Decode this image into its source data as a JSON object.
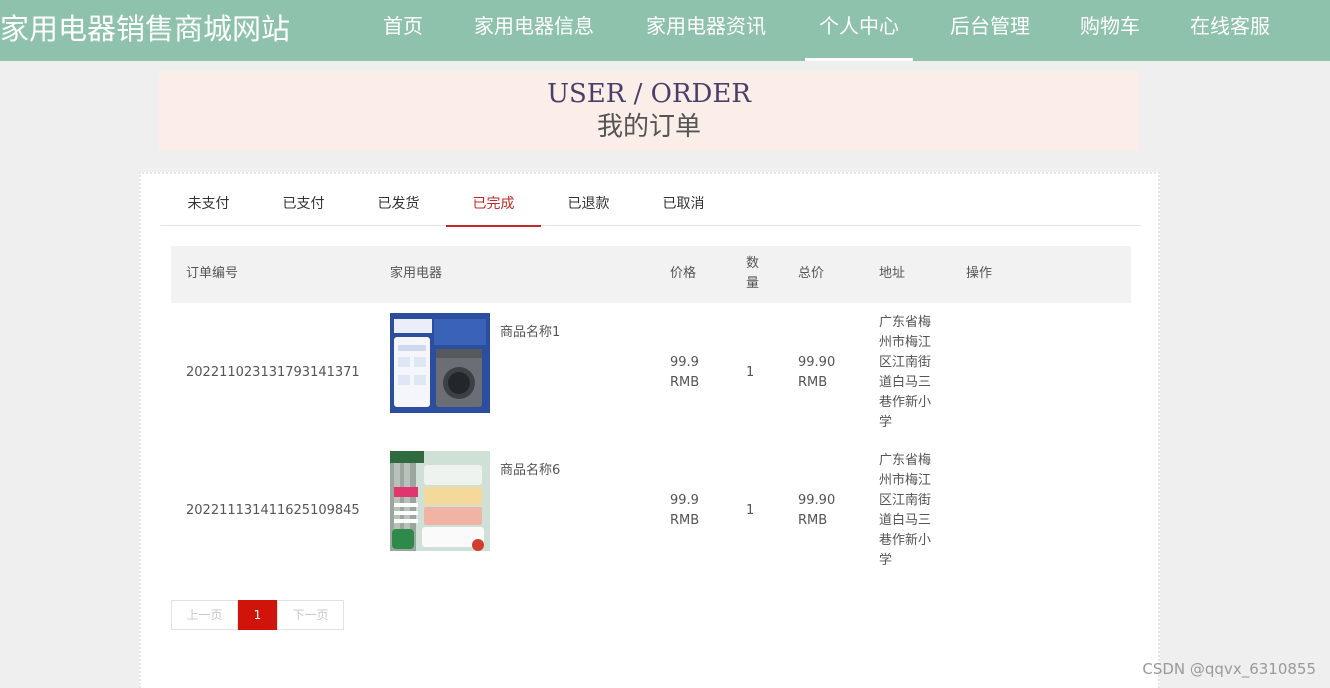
{
  "site": {
    "title": "家用电器销售商城网站",
    "nav": [
      {
        "label": "首页"
      },
      {
        "label": "家用电器信息"
      },
      {
        "label": "家用电器资讯"
      },
      {
        "label": "个人中心",
        "active": true
      },
      {
        "label": "后台管理"
      },
      {
        "label": "购物车"
      },
      {
        "label": "在线客服"
      }
    ]
  },
  "banner": {
    "en": "USER / ORDER",
    "cn": "我的订单"
  },
  "tabs": [
    {
      "label": "未支付"
    },
    {
      "label": "已支付"
    },
    {
      "label": "已发货"
    },
    {
      "label": "已完成",
      "active": true
    },
    {
      "label": "已退款"
    },
    {
      "label": "已取消"
    }
  ],
  "table": {
    "headers": [
      "订单编号",
      "家用电器",
      "价格",
      "数量",
      "总价",
      "地址",
      "操作"
    ],
    "rows": [
      {
        "order_no": "202211023131793141371",
        "product": "商品名称1",
        "thumb": "washing-machine-image",
        "price": "99.9",
        "price_unit": "RMB",
        "qty": "1",
        "total": "99.90",
        "total_unit": "RMB",
        "address": "广东省梅州市梅江区江南街道白马三巷作新小学"
      },
      {
        "order_no": "202211131411625109845",
        "product": "商品名称6",
        "thumb": "fruit-steamer-image",
        "price": "99.9",
        "price_unit": "RMB",
        "qty": "1",
        "total": "99.90",
        "total_unit": "RMB",
        "address": "广东省梅州市梅江区江南街道白马三巷作新小学"
      }
    ]
  },
  "pagination": {
    "prev": "上一页",
    "current": "1",
    "next": "下一页"
  },
  "watermark": "CSDN @qqvx_6310855",
  "colors": {
    "nav_bg": "#8fc2ad",
    "accent": "#c12a26",
    "page_btn": "#d0140c",
    "banner_bg": "#fbeee8"
  }
}
